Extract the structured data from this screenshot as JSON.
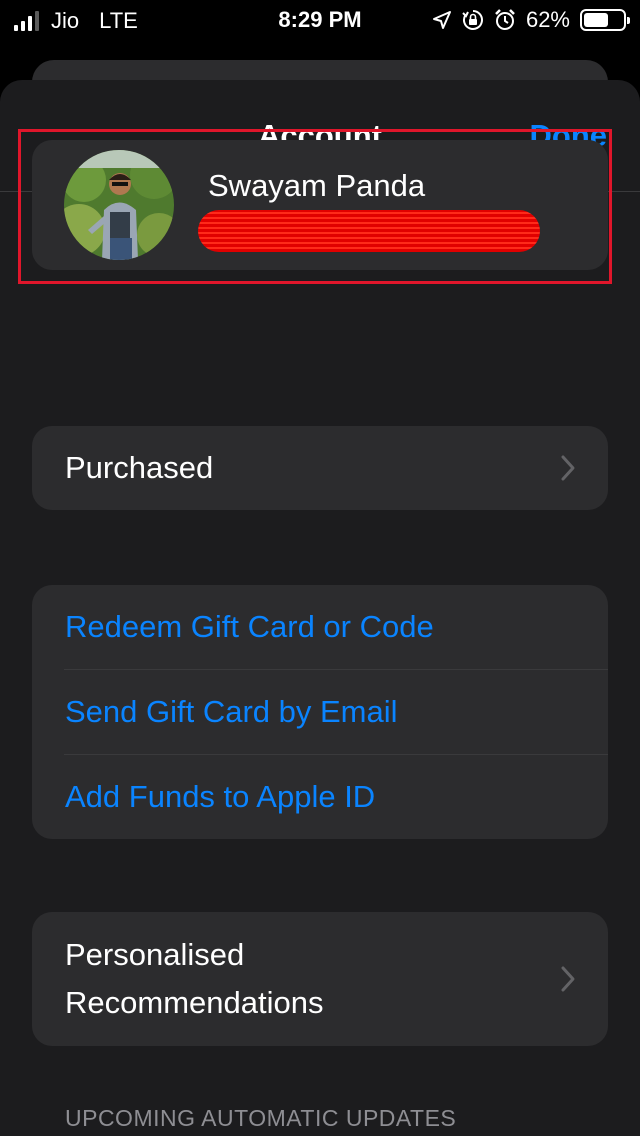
{
  "status_bar": {
    "carrier": "Jio",
    "network": "LTE",
    "time": "8:29 PM",
    "battery": "62%",
    "battery_level": 0.62,
    "icons": [
      "location-icon",
      "rotation-lock-icon",
      "alarm-icon"
    ]
  },
  "nav": {
    "title": "Account",
    "done_label": "Done"
  },
  "profile": {
    "name": "Swayam Panda"
  },
  "purchased": {
    "label": "Purchased"
  },
  "gift_section": {
    "items": [
      {
        "label": "Redeem Gift Card or Code"
      },
      {
        "label": "Send Gift Card by Email"
      },
      {
        "label": "Add Funds to Apple ID"
      }
    ]
  },
  "personalised": {
    "line1": "Personalised",
    "line2": "Recommendations"
  },
  "upcoming_header": "UPCOMING AUTOMATIC UPDATES",
  "colors": {
    "accent": "#0a84ff",
    "background": "#1c1c1e",
    "cell": "#2c2c2e",
    "highlight": "#e0162b"
  }
}
